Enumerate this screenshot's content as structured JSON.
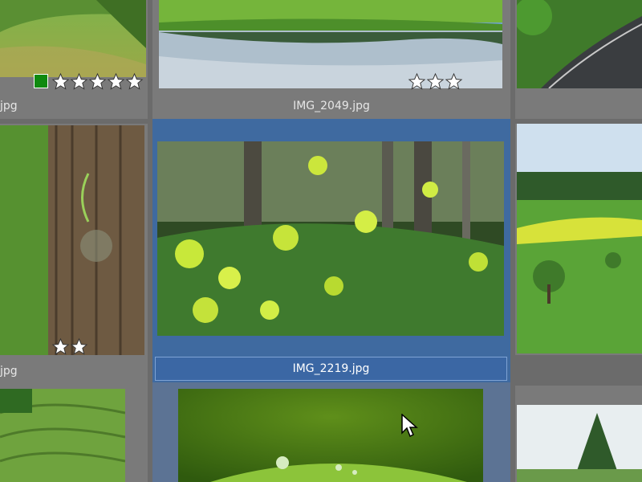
{
  "thumbnails": [
    {
      "name": "thumb-top-left",
      "caption": "jpg",
      "rating": 5,
      "color_label": "#0f8a0f"
    },
    {
      "name": "thumb-top-center",
      "caption": "IMG_2049.jpg",
      "rating": 3
    },
    {
      "name": "thumb-top-right",
      "caption": ""
    },
    {
      "name": "thumb-mid-left",
      "caption": "jpg",
      "rating": 2
    },
    {
      "name": "thumb-mid-center",
      "caption": "IMG_2219.jpg",
      "selected": true
    },
    {
      "name": "thumb-mid-right",
      "caption": ""
    },
    {
      "name": "thumb-bottom-left",
      "caption": ""
    },
    {
      "name": "thumb-bottom-center",
      "caption": ""
    },
    {
      "name": "thumb-bottom-right",
      "caption": ""
    }
  ],
  "colors": {
    "selection": "#3f6aa0",
    "color_label_green": "#0f8a0f"
  }
}
